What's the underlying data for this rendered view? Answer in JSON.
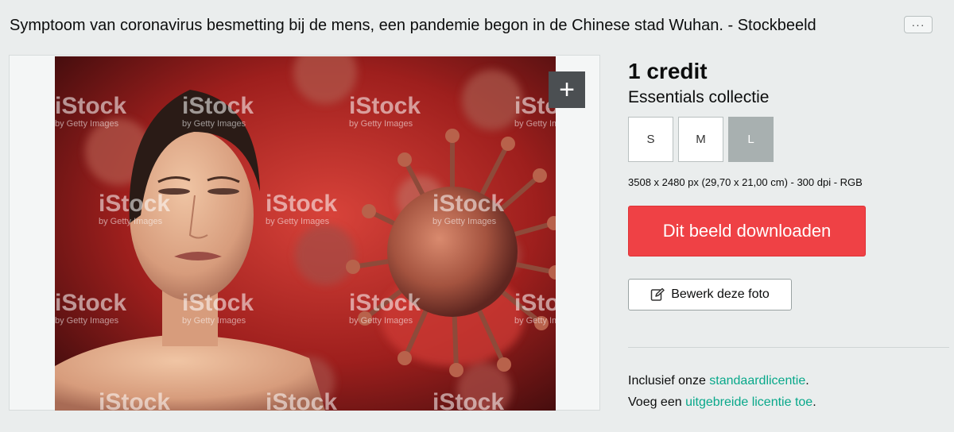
{
  "page": {
    "title": "Symptoom van coronavirus besmetting bij de mens, een pandemie begon in de Chinese stad Wuhan. - Stockbeeld",
    "more_label": "···"
  },
  "preview": {
    "watermark_brand": "iStock",
    "watermark_sub": "by Getty Images",
    "add_label": "+"
  },
  "purchase": {
    "price": "1 credit",
    "collection": "Essentials collectie",
    "sizes": [
      {
        "label": "S",
        "selected": false
      },
      {
        "label": "M",
        "selected": false
      },
      {
        "label": "L",
        "selected": true
      }
    ],
    "dimensions": "3508 x 2480 px (29,70 x 21,00 cm) - 300 dpi - RGB",
    "download_label": "Dit beeld downloaden",
    "edit_label": "Bewerk deze foto"
  },
  "license": {
    "line1_prefix": "Inclusief onze ",
    "line1_link": "standaardlicentie",
    "line1_suffix": ".",
    "line2_prefix": "Voeg een ",
    "line2_link": "uitgebreide licentie toe",
    "line2_suffix": "."
  },
  "colors": {
    "download": "#ef4145",
    "link": "#08a88a",
    "background": "#eaeded"
  }
}
